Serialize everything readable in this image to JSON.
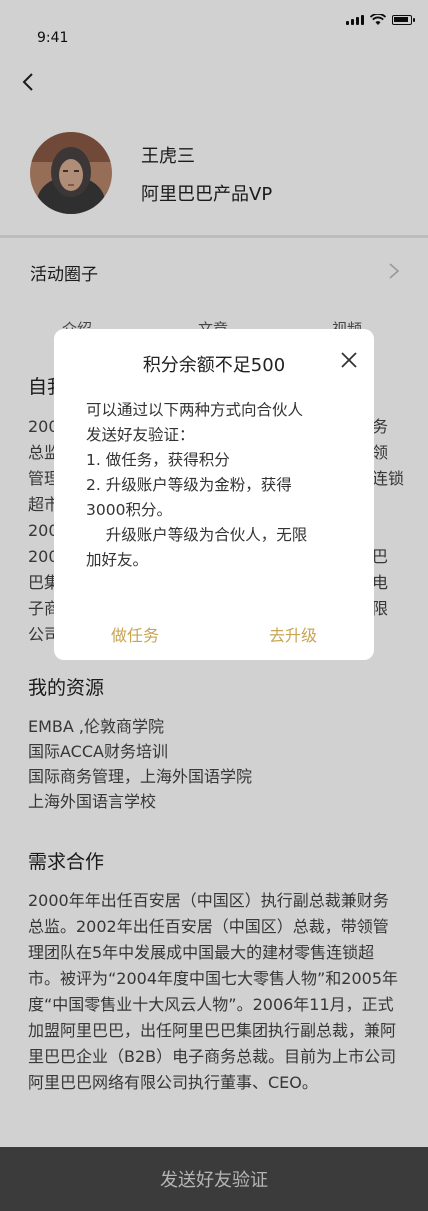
{
  "status": {
    "time": "9:41"
  },
  "profile": {
    "name": "王虎三",
    "title": "阿里巴巴产品VP"
  },
  "circle": {
    "label": "活动圈子"
  },
  "tabs": [
    "介绍",
    "文章",
    "视频"
  ],
  "intro": {
    "title": "自我",
    "lines": [
      "200",
      "总监",
      "管理",
      "超市",
      "200",
      "200",
      "巴集",
      "子商",
      "公司"
    ],
    "right_lines": [
      "务",
      "领",
      "连锁",
      "",
      "",
      "巴",
      "电",
      "限"
    ]
  },
  "resources": {
    "title": "我的资源",
    "items": [
      "EMBA ,伦敦商学院",
      "国际ACCA财务培训",
      "国际商务管理，上海外国语学院",
      "上海外国语言学校"
    ]
  },
  "cooperation": {
    "title": "需求合作",
    "text": "2000年年出任百安居（中国区）执行副总裁兼财务总监。2002年出任百安居（中国区）总裁，带领管理团队在5年中发展成中国最大的建材零售连锁超市。被评为“2004年度中国七大零售人物”和2005年度“中国零售业十大风云人物”。2006年11月，正式加盟阿里巴巴，出任阿里巴巴集团执行副总裁，兼阿里巴巴企业（B2B）电子商务总裁。目前为上市公司阿里巴巴网络有限公司执行董事、CEO。"
  },
  "bottom": {
    "label": "发送好友验证"
  },
  "dialog": {
    "title": "积分余额不足500",
    "lines": [
      "可以通过以下两种方式向合伙人",
      "发送好友验证：",
      "1. 做任务，获得积分",
      "2. 升级账户等级为金粉，获得",
      "3000积分。",
      "    升级账户等级为合伙人，无限",
      "加好友。"
    ],
    "btn_task": "做任务",
    "btn_upgrade": "去升级"
  },
  "colors": {
    "accent": "#c8a453",
    "bottom_bar": "#494949"
  }
}
